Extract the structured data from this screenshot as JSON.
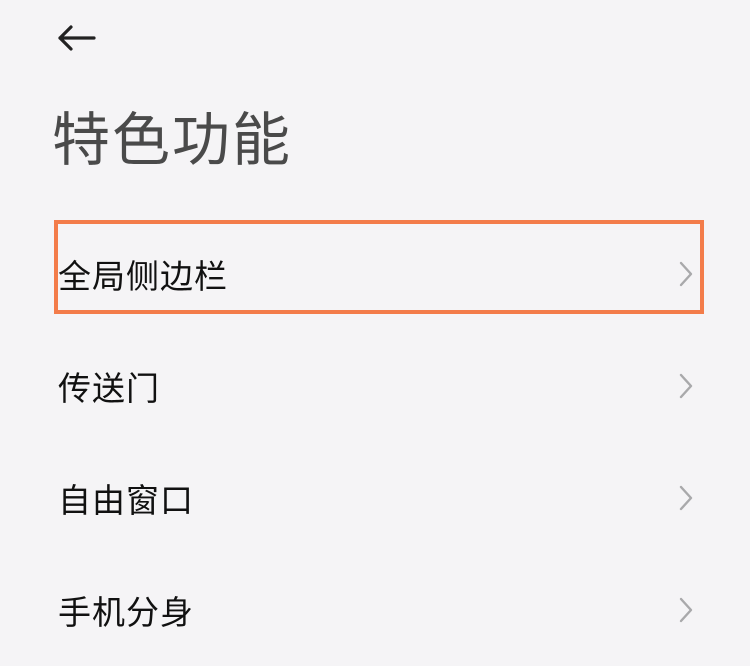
{
  "header": {
    "back_icon": "arrow-left-icon",
    "title": "特色功能"
  },
  "list": {
    "items": [
      {
        "label": "全局侧边栏",
        "icon": "chevron-right-icon"
      },
      {
        "label": "传送门",
        "icon": "chevron-right-icon"
      },
      {
        "label": "自由窗口",
        "icon": "chevron-right-icon"
      },
      {
        "label": "手机分身",
        "icon": "chevron-right-icon"
      }
    ]
  },
  "annotation": {
    "highlight_color": "#f37c4a",
    "highlighted_item": "全局侧边栏"
  }
}
